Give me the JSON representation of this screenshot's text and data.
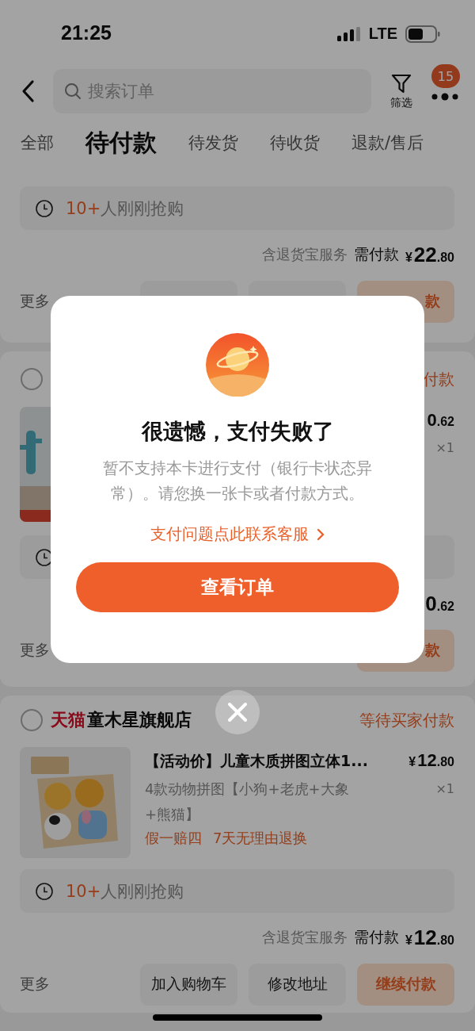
{
  "status_bar": {
    "time": "21:25",
    "network": "LTE"
  },
  "search": {
    "placeholder": "搜索订单"
  },
  "filter": {
    "label": "筛选"
  },
  "more": {
    "badge": "15"
  },
  "tabs": [
    {
      "label": "全部",
      "selected": false
    },
    {
      "label": "待付款",
      "selected": true
    },
    {
      "label": "待发货",
      "selected": false
    },
    {
      "label": "待收货",
      "selected": false
    },
    {
      "label": "退款/售后",
      "selected": false
    }
  ],
  "orders": [
    {
      "kind": "tail",
      "rush": {
        "kind": "text",
        "count": "10+",
        "text": "人刚刚抢购"
      },
      "total": {
        "service": "含退货宝服务",
        "label": "需付款",
        "currency": "¥",
        "amount": "22",
        "cents": ".80"
      },
      "more": "更多",
      "buttons": [
        {
          "primary": false
        },
        {
          "primary": false
        },
        {
          "label": "款",
          "primary": true
        }
      ]
    },
    {
      "kind": "covered",
      "checkbox": {
        "checked": false
      },
      "status": "付款",
      "product": {
        "price": {
          "amount": "0",
          "cents": ".62"
        },
        "quantity": "×1"
      },
      "rush": {
        "kind": "icon"
      },
      "total": {
        "amount": "0",
        "cents": ".62"
      },
      "more": "更多",
      "buttons": [
        {
          "label": "款",
          "primary": true
        }
      ]
    },
    {
      "kind": "full",
      "checkbox": {
        "checked": false
      },
      "shop": {
        "mall": "天猫",
        "name": "童木星旗舰店"
      },
      "status": "等待买家付款",
      "product": {
        "title": "【活动价】儿童木质拼图立体1...",
        "price": {
          "currency": "¥",
          "amount": "12",
          "cents": ".80"
        },
        "sku": "4款动物拼图【小狗+老虎+大象+熊猫】",
        "quantity": "×1",
        "tags": [
          "假一赔四",
          "7天无理由退换"
        ]
      },
      "rush": {
        "kind": "text",
        "count": "10+",
        "text": "人刚刚抢购"
      },
      "total": {
        "service": "含退货宝服务",
        "label": "需付款",
        "currency": "¥",
        "amount": "12",
        "cents": ".80"
      },
      "more": "更多",
      "buttons": [
        {
          "label": "加入购物车",
          "primary": false
        },
        {
          "label": "修改地址",
          "primary": false
        },
        {
          "label": "继续付款",
          "primary": true
        }
      ]
    }
  ],
  "dialog": {
    "title": "很遗憾，支付失败了",
    "message": "暂不支持本卡进行支付（银行卡状态异常）。请您换一张卡或者付款方式。",
    "link": "支付问题点此联系客服",
    "button": "查看订单"
  }
}
